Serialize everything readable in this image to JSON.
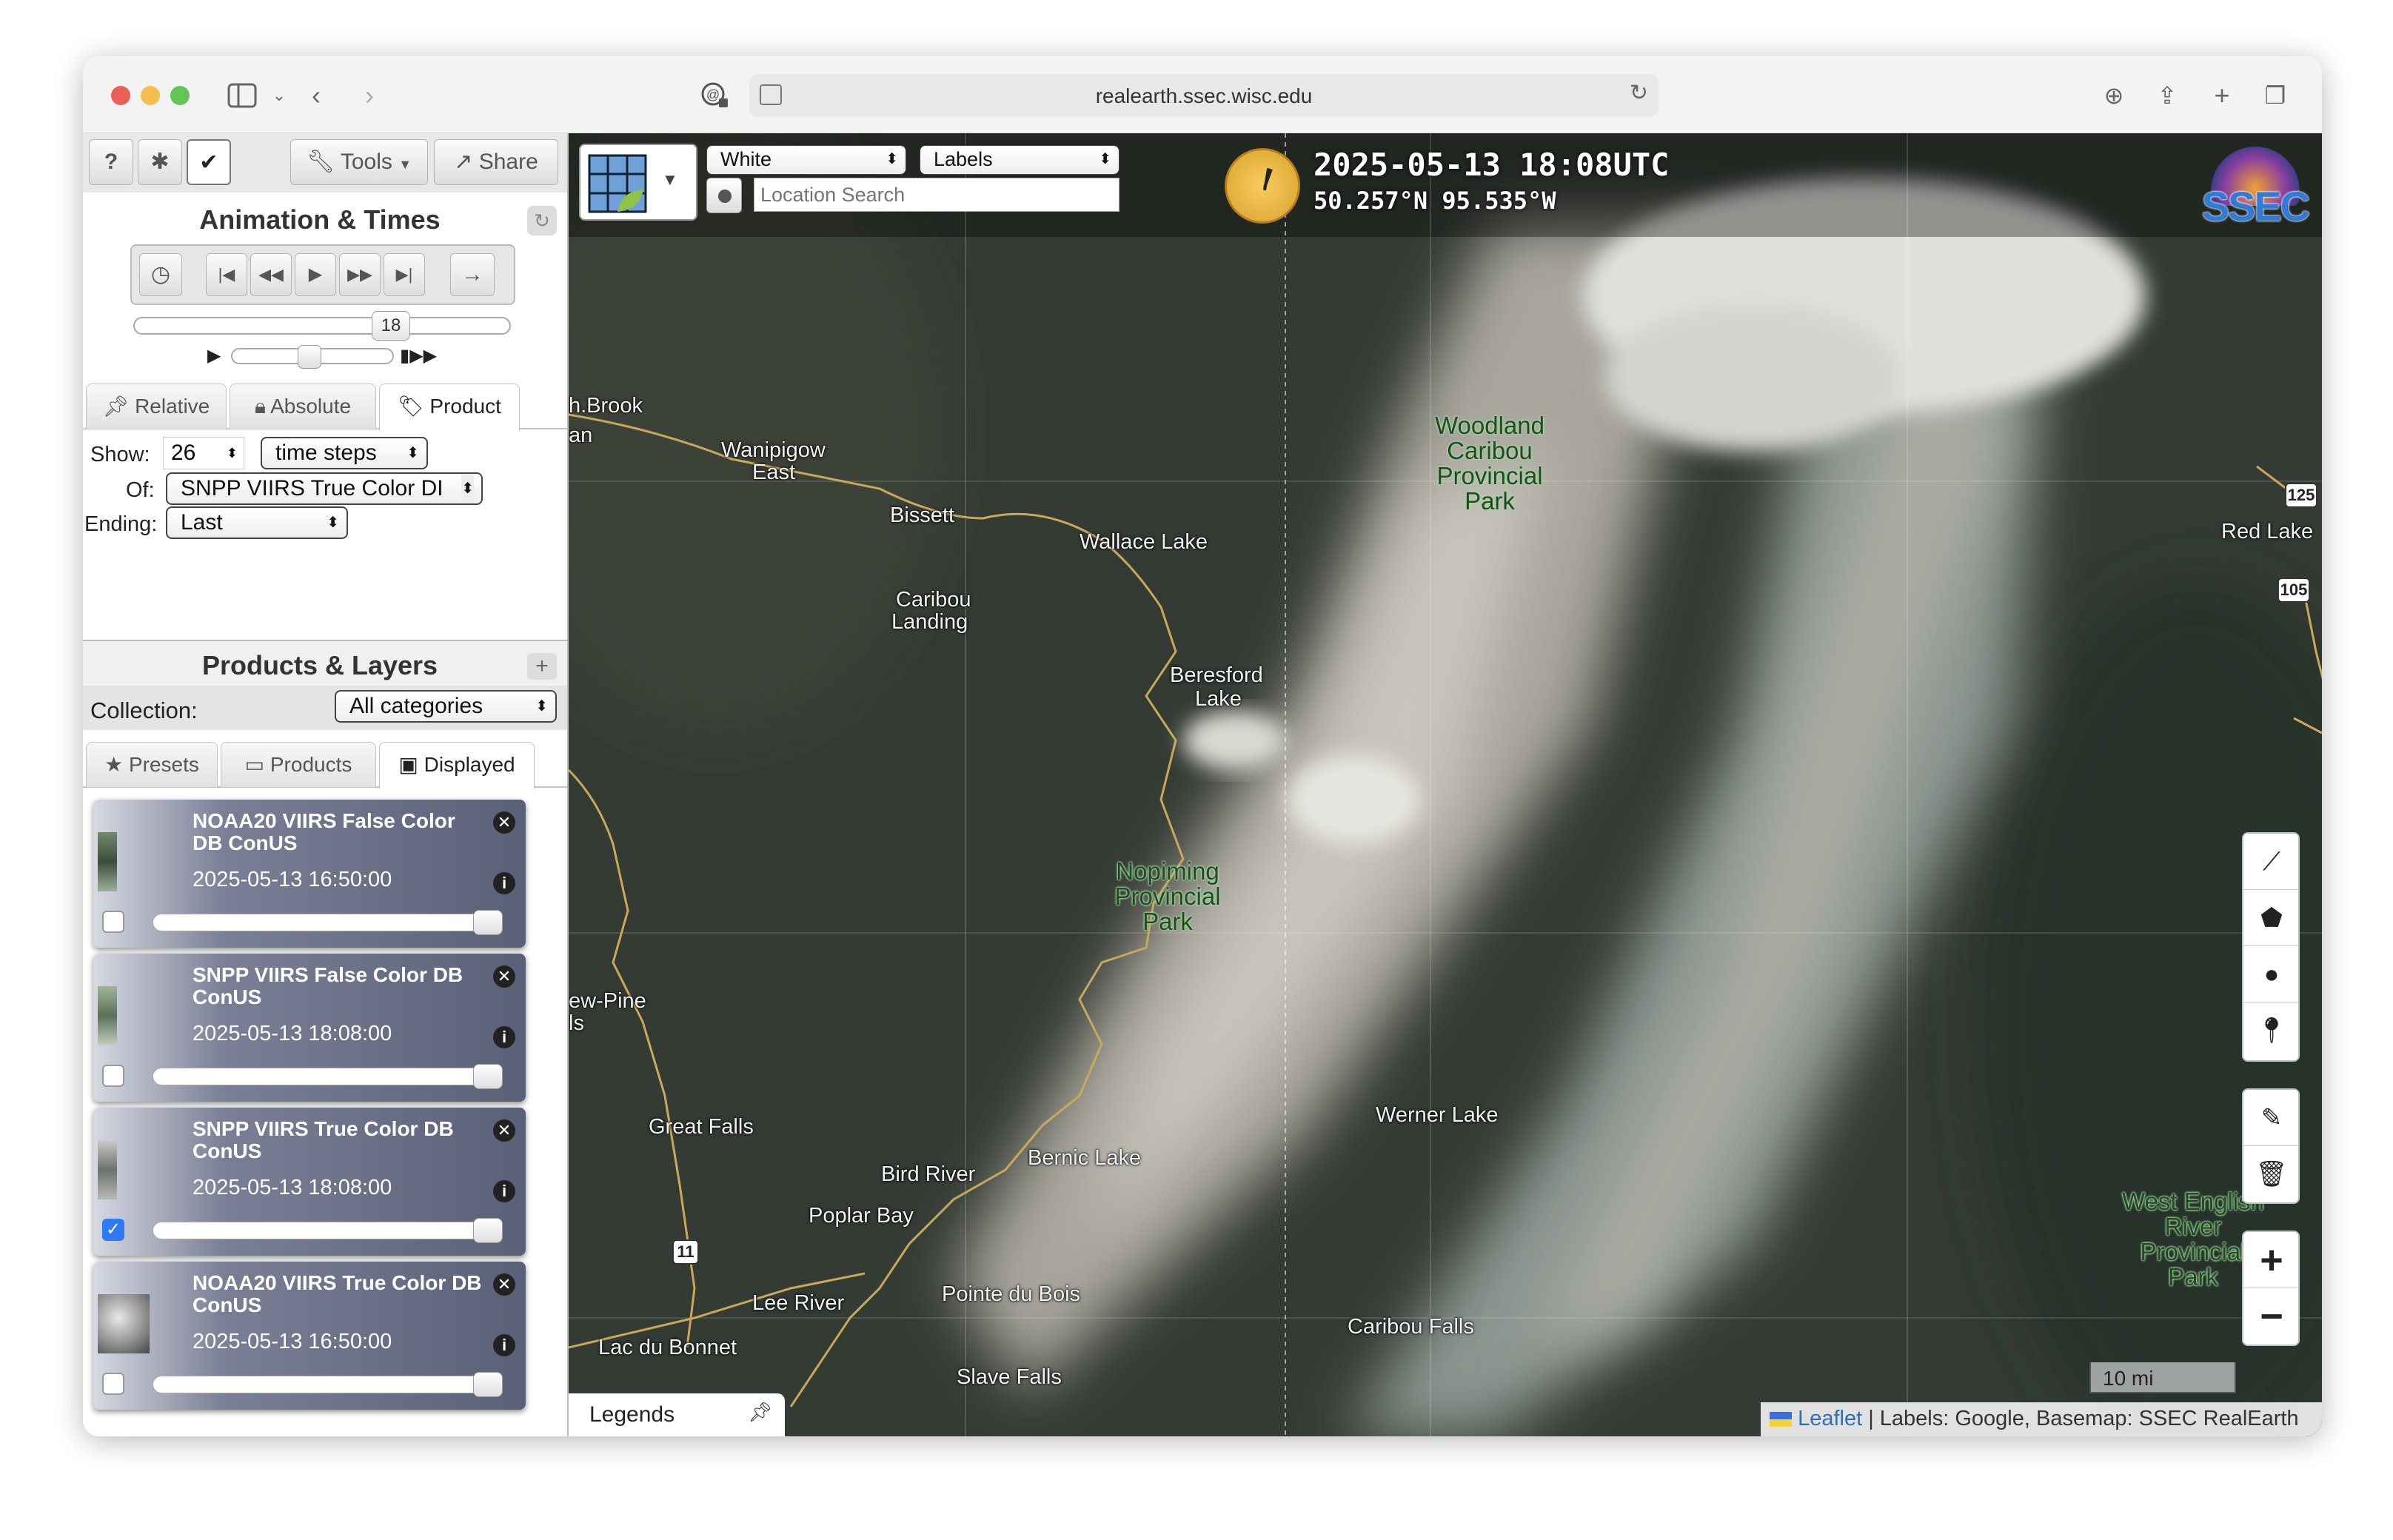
{
  "browser": {
    "url": "realearth.ssec.wisc.edu"
  },
  "toolbar": {
    "help_label": "?",
    "tools_label": "Tools",
    "share_label": "Share"
  },
  "animation": {
    "title": "Animation & Times",
    "frame_label": "18",
    "tabs": [
      "Relative",
      "Absolute",
      "Product"
    ],
    "show_label": "Show:",
    "show_value": "26",
    "unit_select": "time steps",
    "of_label": "Of:",
    "of_select": "SNPP VIIRS True Color DI",
    "ending_label": "Ending:",
    "ending_select": "Last"
  },
  "products": {
    "title": "Products & Layers",
    "collection_label": "Collection:",
    "collection_select": "All categories",
    "tabs": [
      "Presets",
      "Products",
      "Displayed"
    ],
    "layers": [
      {
        "name": "NOAA20 VIIRS False Color DB ConUS",
        "time": "2025-05-13 16:50:00",
        "checked": false
      },
      {
        "name": "SNPP VIIRS False Color DB ConUS",
        "time": "2025-05-13 18:08:00",
        "checked": false
      },
      {
        "name": "SNPP VIIRS True Color DB ConUS",
        "time": "2025-05-13 18:08:00",
        "checked": true
      },
      {
        "name": "NOAA20 VIIRS True Color DB ConUS",
        "time": "2025-05-13 16:50:00",
        "checked": false
      }
    ]
  },
  "map": {
    "basemap_select": "White",
    "labels_select": "Labels",
    "search_placeholder": "Location Search",
    "datetime": "2025-05-13 18:08UTC",
    "coords": "50.257°N 95.535°W",
    "logo_text": "SSEC",
    "scale": "10 mi",
    "legends_label": "Legends",
    "attribution_leaflet": "Leaflet",
    "attribution_rest": " | Labels: Google, Basemap: SSEC RealEarth",
    "places": {
      "h_brook": "h.Brook",
      "an": "an",
      "wanipigow": "Wanipigow",
      "wanipigow_east": "East",
      "bissett": "Bissett",
      "wallace_lake": "Wallace Lake",
      "caribou_landing_1": "Caribou",
      "caribou_landing_2": "Landing",
      "beresford_1": "Beresford",
      "beresford_2": "Lake",
      "pine_falls_1": "ew-Pine",
      "pine_falls_2": "ls",
      "great_falls": "Great Falls",
      "bird_river": "Bird River",
      "bernic_lake": "Bernic Lake",
      "poplar_bay": "Poplar Bay",
      "lee_river": "Lee River",
      "pointe_du_bois": "Pointe du Bois",
      "lac_du_bonnet": "Lac du Bonnet",
      "slave_falls": "Slave Falls",
      "werner_lake": "Werner Lake",
      "caribou_falls": "Caribou Falls",
      "red_lake": "Red Lake"
    },
    "parks": {
      "woodland_caribou": [
        "Woodland",
        "Caribou",
        "Provincial",
        "Park"
      ],
      "nopiming": [
        "Nopiming",
        "Provincial",
        "Park"
      ],
      "west_english": [
        "West English",
        "River",
        "Provincial",
        "Park"
      ]
    },
    "shields": [
      "125",
      "105",
      "11"
    ]
  }
}
